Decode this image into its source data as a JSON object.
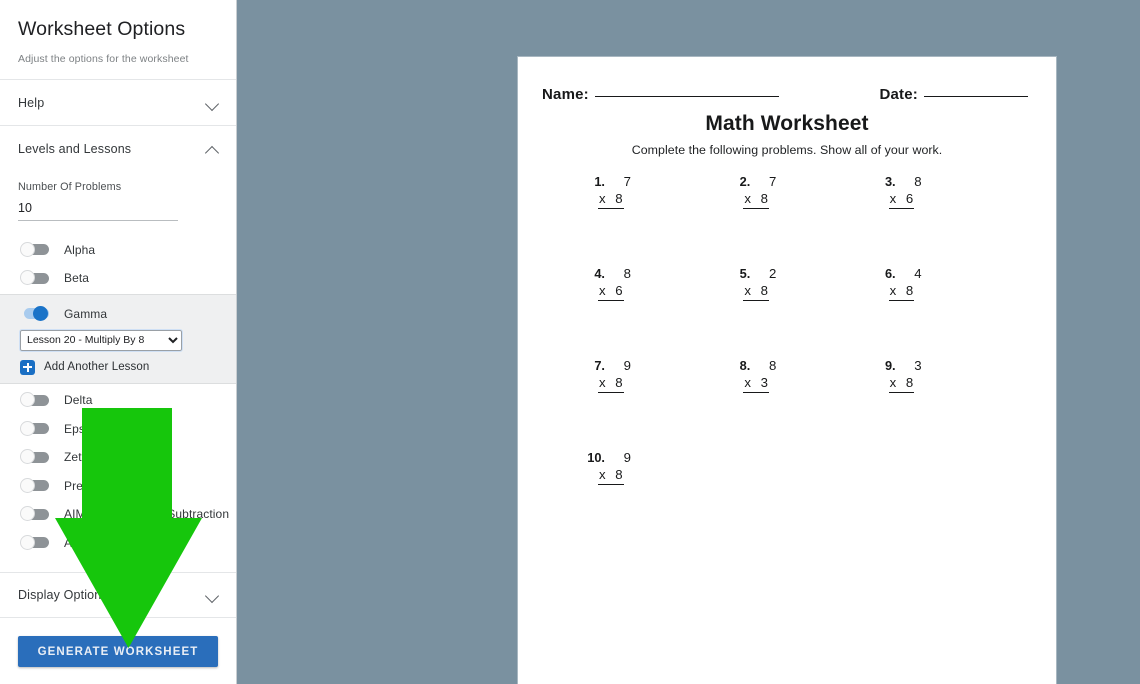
{
  "theme": {
    "background": "#7a91a0",
    "accent_blue": "#2a6ebb",
    "toggle_on": "#1a73c8",
    "arrow_green": "#16c60c"
  },
  "sidebar": {
    "title": "Worksheet Options",
    "subtitle": "Adjust the options for the worksheet",
    "sections": [
      {
        "label": "Help",
        "expanded": false,
        "chevron": "chevron-down-icon"
      },
      {
        "label": "Levels and Lessons",
        "expanded": true,
        "chevron": "chevron-up-icon"
      },
      {
        "label": "Display Options",
        "expanded": false,
        "chevron": "chevron-down-icon"
      }
    ],
    "number_of_problems": {
      "label": "Number Of Problems",
      "value": "10",
      "placeholder": "Number Of Problems"
    },
    "levels": [
      {
        "label": "Alpha",
        "on": false
      },
      {
        "label": "Beta",
        "on": false
      },
      {
        "label": "Gamma",
        "on": true
      },
      {
        "label": "Delta",
        "on": false
      },
      {
        "label": "Epsilon",
        "on": false
      },
      {
        "label": "Zeta",
        "on": false
      },
      {
        "label": "Pre-Algebra",
        "on": false
      },
      {
        "label": "AIM - Addition and Subtraction",
        "on": false
      },
      {
        "label": "AIM - Multiplication",
        "on": false
      }
    ],
    "lesson_select": {
      "selected": "Lesson 20 - Multiply By 8",
      "options": [
        "Lesson 20 - Multiply By 8"
      ]
    },
    "add_another_lesson": {
      "label": "Add Another Lesson",
      "icon": "plus-square-icon"
    },
    "generate_button": "GENERATE WORKSHEET"
  },
  "annotation": {
    "arrow": "down-arrow-annotation",
    "color": "#16c60c"
  },
  "worksheet": {
    "name_label": "Name:",
    "date_label": "Date:",
    "title": "Math Worksheet",
    "instructions": "Complete the following problems. Show all of your work.",
    "problems": [
      {
        "num": "1.",
        "top": "7",
        "op": "x",
        "bottom": "8"
      },
      {
        "num": "2.",
        "top": "7",
        "op": "x",
        "bottom": "8"
      },
      {
        "num": "3.",
        "top": "8",
        "op": "x",
        "bottom": "6"
      },
      {
        "num": "4.",
        "top": "8",
        "op": "x",
        "bottom": "6"
      },
      {
        "num": "5.",
        "top": "2",
        "op": "x",
        "bottom": "8"
      },
      {
        "num": "6.",
        "top": "4",
        "op": "x",
        "bottom": "8"
      },
      {
        "num": "7.",
        "top": "9",
        "op": "x",
        "bottom": "8"
      },
      {
        "num": "8.",
        "top": "8",
        "op": "x",
        "bottom": "3"
      },
      {
        "num": "9.",
        "top": "3",
        "op": "x",
        "bottom": "8"
      },
      {
        "num": "10.",
        "top": "9",
        "op": "x",
        "bottom": "8"
      }
    ]
  }
}
